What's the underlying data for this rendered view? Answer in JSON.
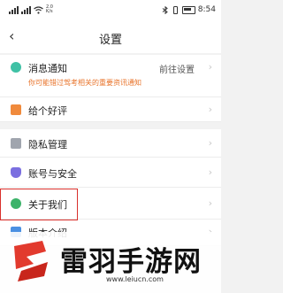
{
  "statusbar": {
    "network_speed": "2.0 K/s",
    "battery": "",
    "time": "8:54"
  },
  "header": {
    "back_icon": "chevron-left-icon",
    "title": "设置"
  },
  "settings": {
    "notification": {
      "label": "消息通知",
      "value": "前往设置",
      "subtitle": "你可能错过驾考相关的重要资讯通知",
      "icon_color": "#3fc1a5"
    },
    "rating": {
      "label": "给个好评",
      "icon_color": "#f08a3c"
    },
    "privacy": {
      "label": "隐私管理",
      "icon_color": "#a0a5ae"
    },
    "account": {
      "label": "账号与安全",
      "icon_color": "#7b6fe0"
    },
    "about": {
      "label": "关于我们",
      "icon_color": "#3db36a"
    },
    "version": {
      "label": "版本介绍",
      "icon_color": "#4a90e2"
    }
  },
  "highlight_color": "#d9302c",
  "watermark": {
    "title": "雷羽手游网",
    "url": "www.leiucn.com",
    "brand_color": "#e23a2e"
  }
}
